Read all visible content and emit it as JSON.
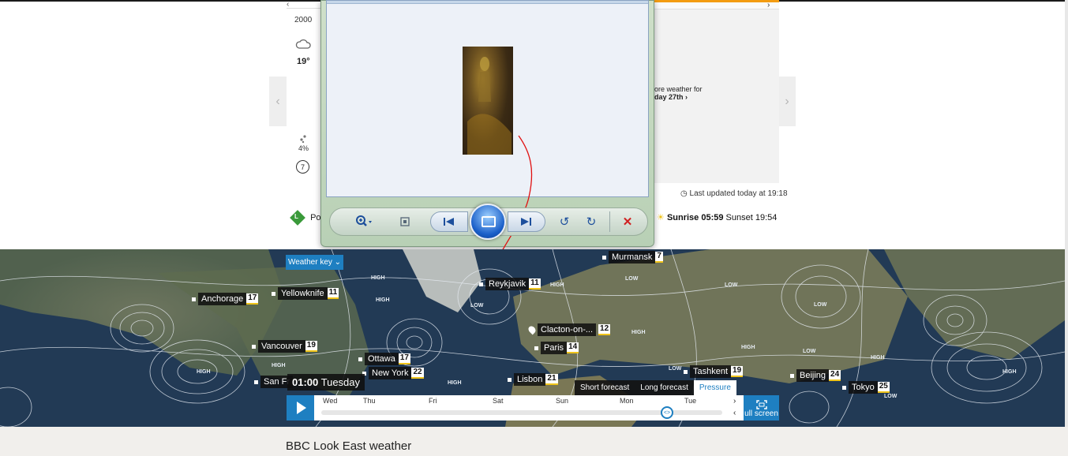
{
  "forecast_left": {
    "time": "2000",
    "temp": "19°",
    "rain": "4%",
    "wind": "7"
  },
  "pollen": {
    "badge": "L",
    "label": "Po"
  },
  "right_panel": {
    "more_weather_line1": "ore weather for",
    "more_weather_line2": "day 27th"
  },
  "last_updated": "Last updated today at 19:18",
  "sun": {
    "sunrise_label": "Sunrise 05:59",
    "sunset_label": "Sunset 19:54"
  },
  "map": {
    "weather_key": "Weather key",
    "current_time": "01:00",
    "current_day": "Tuesday",
    "tabs": [
      "Short forecast",
      "Long forecast",
      "Pressure"
    ],
    "active_tab": "Pressure",
    "days": [
      "Wed",
      "Thu",
      "Fri",
      "Sat",
      "Sun",
      "Mon",
      "Tue"
    ],
    "fullscreen_label": "ull screen",
    "cities": [
      {
        "name": "Murmansk",
        "temp": "7"
      },
      {
        "name": "Reykjavik",
        "temp": "11"
      },
      {
        "name": "Anchorage",
        "temp": "17"
      },
      {
        "name": "Yellowknife",
        "temp": "11"
      },
      {
        "name": "Clacton-on-...",
        "temp": "12"
      },
      {
        "name": "Paris",
        "temp": "14"
      },
      {
        "name": "Vancouver",
        "temp": "19"
      },
      {
        "name": "Ottawa",
        "temp": "17"
      },
      {
        "name": "New York",
        "temp": "22"
      },
      {
        "name": "Tashkent",
        "temp": "19"
      },
      {
        "name": "Lisbon",
        "temp": "21"
      },
      {
        "name": "Beijing",
        "temp": "24"
      },
      {
        "name": "Tokyo",
        "temp": "25"
      },
      {
        "name": "San Fr",
        "temp": ""
      }
    ],
    "pressure_labels": [
      "HIGH",
      "LOW"
    ]
  },
  "section_title": "BBC Look East weather",
  "photo_viewer": {
    "toolbar_icons": [
      "zoom-icon",
      "fit-icon",
      "previous-icon",
      "slideshow-icon",
      "next-icon",
      "rotate-left-icon",
      "rotate-right-icon",
      "delete-icon"
    ]
  },
  "colors": {
    "accent": "#1e7fc1",
    "orange": "#f39c12",
    "map_sea": "#223a55"
  }
}
